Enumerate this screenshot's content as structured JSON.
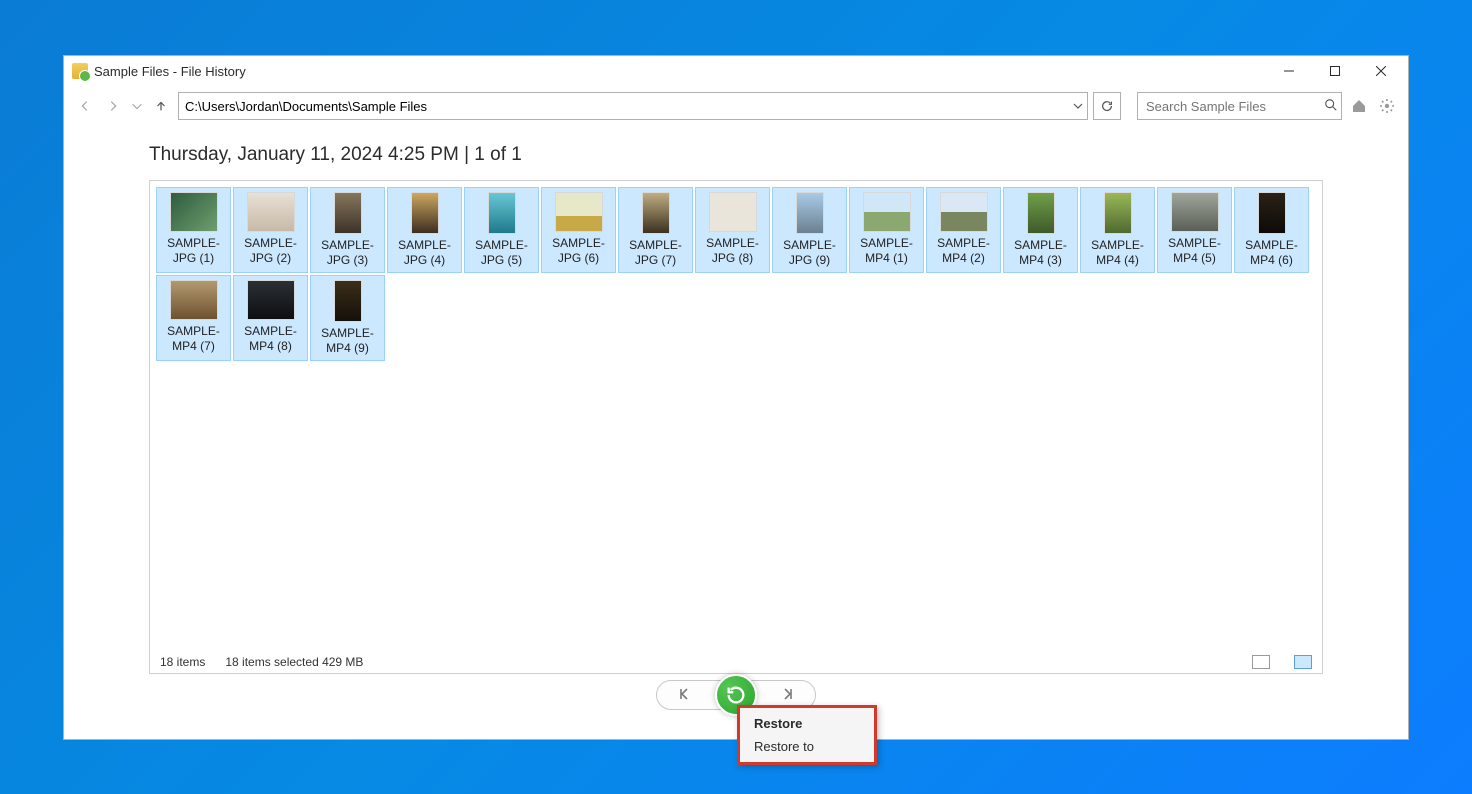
{
  "window": {
    "title": "Sample Files - File History"
  },
  "toolbar": {
    "path": "C:\\Users\\Jordan\\Documents\\Sample Files",
    "search_placeholder": "Search Sample Files"
  },
  "heading": "Thursday, January 11, 2024 4:25 PM    |    1 of 1",
  "files": [
    {
      "label": "SAMPLE-JPG (1)",
      "thumb": "t1"
    },
    {
      "label": "SAMPLE-JPG (2)",
      "thumb": "t2"
    },
    {
      "label": "SAMPLE-JPG (3)",
      "thumb": "t3"
    },
    {
      "label": "SAMPLE-JPG (4)",
      "thumb": "t4"
    },
    {
      "label": "SAMPLE-JPG (5)",
      "thumb": "t5"
    },
    {
      "label": "SAMPLE-JPG (6)",
      "thumb": "t6"
    },
    {
      "label": "SAMPLE-JPG (7)",
      "thumb": "t7"
    },
    {
      "label": "SAMPLE-JPG (8)",
      "thumb": "t8"
    },
    {
      "label": "SAMPLE-JPG (9)",
      "thumb": "t9"
    },
    {
      "label": "SAMPLE-MP4 (1)",
      "thumb": "t10"
    },
    {
      "label": "SAMPLE-MP4 (2)",
      "thumb": "t11"
    },
    {
      "label": "SAMPLE-MP4 (3)",
      "thumb": "t12"
    },
    {
      "label": "SAMPLE-MP4 (4)",
      "thumb": "t13"
    },
    {
      "label": "SAMPLE-MP4 (5)",
      "thumb": "t14"
    },
    {
      "label": "SAMPLE-MP4 (6)",
      "thumb": "t15"
    },
    {
      "label": "SAMPLE-MP4 (7)",
      "thumb": "t16"
    },
    {
      "label": "SAMPLE-MP4 (8)",
      "thumb": "t17"
    },
    {
      "label": "SAMPLE-MP4 (9)",
      "thumb": "t18"
    }
  ],
  "status": {
    "count": "18 items",
    "selected": "18 items selected  429 MB"
  },
  "context_menu": {
    "restore": "Restore",
    "restore_to": "Restore to"
  }
}
